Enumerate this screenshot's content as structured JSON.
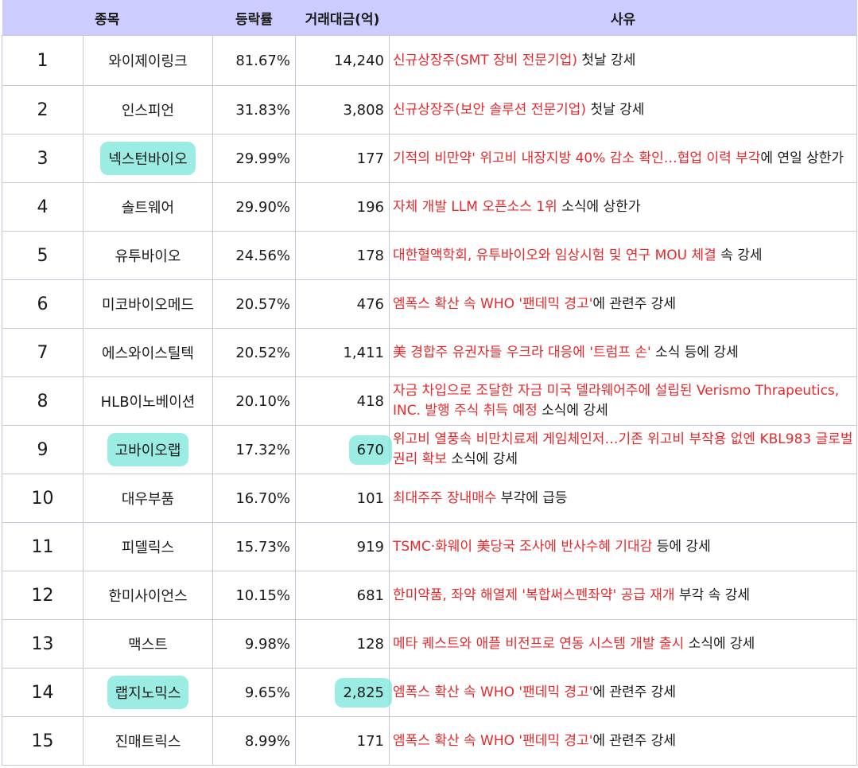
{
  "header": {
    "col_stock": "종목",
    "col_rate": "등락률",
    "col_amount": "거래대금(억)",
    "col_reason": "사유"
  },
  "rows": [
    {
      "rank": "1",
      "name": "와이제이링크",
      "rate": "81.67%",
      "amount": "14,240",
      "reason_red": "신규상장주(SMT 장비 전문기업)",
      "reason_black": " 첫날 강세"
    },
    {
      "rank": "2",
      "name": "인스피언",
      "rate": "31.83%",
      "amount": "3,808",
      "reason_red": "신규상장주(보안 솔루션 전문기업)",
      "reason_black": " 첫날 강세"
    },
    {
      "rank": "3",
      "name": "넥스턴바이오",
      "rate": "29.99%",
      "amount": "177",
      "reason_red": "기적의 비만약' 위고비 내장지방 40% 감소 확인…협업 이력 부각",
      "reason_black": "에 연일 상한가"
    },
    {
      "rank": "4",
      "name": "솔트웨어",
      "rate": "29.90%",
      "amount": "196",
      "reason_red": "자체 개발 LLM 오픈소스 1위",
      "reason_black": " 소식에 상한가"
    },
    {
      "rank": "5",
      "name": "유투바이오",
      "rate": "24.56%",
      "amount": "178",
      "reason_red": "대한혈액학회, 유투바이오와 임상시험 및 연구 MOU 체결",
      "reason_black": " 속 강세"
    },
    {
      "rank": "6",
      "name": "미코바이오메드",
      "rate": "20.57%",
      "amount": "476",
      "reason_red": "엠폭스 확산 속 WHO '팬데믹 경고'",
      "reason_black": "에 관련주 강세"
    },
    {
      "rank": "7",
      "name": "에스와이스틸텍",
      "rate": "20.52%",
      "amount": "1,411",
      "reason_red": "美 경합주 유권자들 우크라 대응에 '트럼프 손'",
      "reason_black": " 소식 등에 강세"
    },
    {
      "rank": "8",
      "name": "HLB이노베이션",
      "rate": "20.10%",
      "amount": "418",
      "reason_red": "자금 차입으로 조달한 자금 미국 델라웨어주에 설립된 Verismo Thrapeutics, INC. 발행 주식 취득 예정",
      "reason_black": " 소식에 강세"
    },
    {
      "rank": "9",
      "name": "고바이오랩",
      "rate": "17.32%",
      "amount": "670",
      "reason_red": "위고비 열풍속 비만치료제 게임체인저…기존 위고비 부작용 없엔 KBL983 글로벌 권리 확보",
      "reason_black": " 소식에 강세"
    },
    {
      "rank": "10",
      "name": "대우부품",
      "rate": "16.70%",
      "amount": "101",
      "reason_red": "최대주주 장내매수",
      "reason_black": " 부각에 급등"
    },
    {
      "rank": "11",
      "name": "피델릭스",
      "rate": "15.73%",
      "amount": "919",
      "reason_red": "TSMC·화웨이 美당국 조사에 반사수혜 기대감",
      "reason_black": " 등에 강세"
    },
    {
      "rank": "12",
      "name": "한미사이언스",
      "rate": "10.15%",
      "amount": "681",
      "reason_red": "한미약품, 좌약 해열제 '복합써스펜좌약' 공급 재개",
      "reason_black": " 부각 속 강세"
    },
    {
      "rank": "13",
      "name": "맥스트",
      "rate": "9.98%",
      "amount": "128",
      "reason_red": "메타 퀘스트와 애플 비전프로 연동 시스템 개발 출시",
      "reason_black": " 소식에 강세"
    },
    {
      "rank": "14",
      "name": "랩지노믹스",
      "rate": "9.65%",
      "amount": "2,825",
      "reason_red": "엠폭스 확산 속 WHO '팬데믹 경고'",
      "reason_black": "에 관련주 강세"
    },
    {
      "rank": "15",
      "name": "진매트릭스",
      "rate": "8.99%",
      "amount": "171",
      "reason_red": "엠폭스 확산 속 WHO '팬데믹 경고'",
      "reason_black": "에 관련주 강세"
    }
  ],
  "colors": {
    "header_bg": "#ccccff",
    "reason_red": "#e8282b",
    "highlight": "#7ae6d9",
    "border": "#c4c7d8"
  }
}
